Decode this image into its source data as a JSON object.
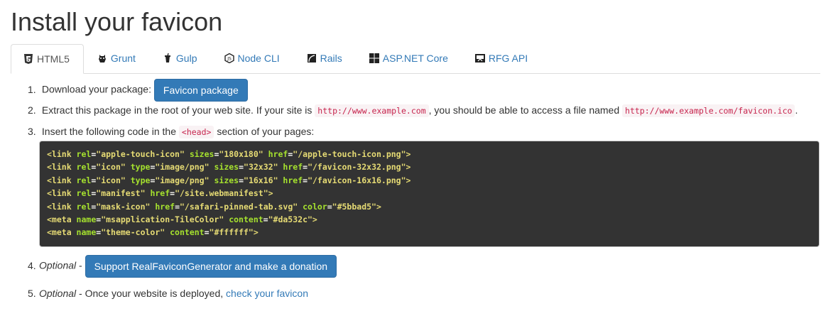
{
  "page": {
    "title": "Install your favicon"
  },
  "tabs": [
    {
      "label": "HTML5",
      "icon": "html5-icon",
      "active": true
    },
    {
      "label": "Grunt",
      "icon": "grunt-icon"
    },
    {
      "label": "Gulp",
      "icon": "gulp-icon"
    },
    {
      "label": "Node CLI",
      "icon": "nodejs-icon"
    },
    {
      "label": "Rails",
      "icon": "rails-icon"
    },
    {
      "label": "ASP.NET Core",
      "icon": "windows-icon"
    },
    {
      "label": "RFG API",
      "icon": "api-icon"
    }
  ],
  "steps": {
    "s1": {
      "num": "1.",
      "text": "Download your package:",
      "button": "Favicon package"
    },
    "s2": {
      "num": "2.",
      "text_a": "Extract this package in the root of your web site. If your site is",
      "code_a": "http://www.example.com",
      "text_b": ", you should be able to access a file named",
      "code_b": "http://www.example.com/favicon.ico",
      "text_c": "."
    },
    "s3": {
      "num": "3.",
      "text_a": "Insert the following code in the",
      "code": "<head>",
      "text_b": "section of your pages:"
    },
    "s4": {
      "num": "4.",
      "optional": "Optional",
      "dash": " - ",
      "button": "Support RealFaviconGenerator and make a donation"
    },
    "s5": {
      "num": "5.",
      "optional": "Optional",
      "text": " - Once your website is deployed, ",
      "link": "check your favicon"
    }
  },
  "code_lines": [
    [
      [
        "tag",
        "<link "
      ],
      [
        "attr",
        "rel"
      ],
      [
        "eq",
        "="
      ],
      [
        "val",
        "\"apple-touch-icon\" "
      ],
      [
        "attr",
        "sizes"
      ],
      [
        "eq",
        "="
      ],
      [
        "val",
        "\"180x180\" "
      ],
      [
        "attr",
        "href"
      ],
      [
        "eq",
        "="
      ],
      [
        "val",
        "\"/apple-touch-icon.png\""
      ],
      [
        "tag",
        ">"
      ]
    ],
    [
      [
        "tag",
        "<link "
      ],
      [
        "attr",
        "rel"
      ],
      [
        "eq",
        "="
      ],
      [
        "val",
        "\"icon\" "
      ],
      [
        "attr",
        "type"
      ],
      [
        "eq",
        "="
      ],
      [
        "val",
        "\"image/png\" "
      ],
      [
        "attr",
        "sizes"
      ],
      [
        "eq",
        "="
      ],
      [
        "val",
        "\"32x32\" "
      ],
      [
        "attr",
        "href"
      ],
      [
        "eq",
        "="
      ],
      [
        "val",
        "\"/favicon-32x32.png\""
      ],
      [
        "tag",
        ">"
      ]
    ],
    [
      [
        "tag",
        "<link "
      ],
      [
        "attr",
        "rel"
      ],
      [
        "eq",
        "="
      ],
      [
        "val",
        "\"icon\" "
      ],
      [
        "attr",
        "type"
      ],
      [
        "eq",
        "="
      ],
      [
        "val",
        "\"image/png\" "
      ],
      [
        "attr",
        "sizes"
      ],
      [
        "eq",
        "="
      ],
      [
        "val",
        "\"16x16\" "
      ],
      [
        "attr",
        "href"
      ],
      [
        "eq",
        "="
      ],
      [
        "val",
        "\"/favicon-16x16.png\""
      ],
      [
        "tag",
        ">"
      ]
    ],
    [
      [
        "tag",
        "<link "
      ],
      [
        "attr",
        "rel"
      ],
      [
        "eq",
        "="
      ],
      [
        "val",
        "\"manifest\" "
      ],
      [
        "attr",
        "href"
      ],
      [
        "eq",
        "="
      ],
      [
        "val",
        "\"/site.webmanifest\""
      ],
      [
        "tag",
        ">"
      ]
    ],
    [
      [
        "tag",
        "<link "
      ],
      [
        "attr",
        "rel"
      ],
      [
        "eq",
        "="
      ],
      [
        "val",
        "\"mask-icon\" "
      ],
      [
        "attr",
        "href"
      ],
      [
        "eq",
        "="
      ],
      [
        "val",
        "\"/safari-pinned-tab.svg\" "
      ],
      [
        "attr",
        "color"
      ],
      [
        "eq",
        "="
      ],
      [
        "val",
        "\"#5bbad5\""
      ],
      [
        "tag",
        ">"
      ]
    ],
    [
      [
        "tag",
        "<meta "
      ],
      [
        "attr",
        "name"
      ],
      [
        "eq",
        "="
      ],
      [
        "val",
        "\"msapplication-TileColor\" "
      ],
      [
        "attr",
        "content"
      ],
      [
        "eq",
        "="
      ],
      [
        "val",
        "\"#da532c\""
      ],
      [
        "tag",
        ">"
      ]
    ],
    [
      [
        "tag",
        "<meta "
      ],
      [
        "attr",
        "name"
      ],
      [
        "eq",
        "="
      ],
      [
        "val",
        "\"theme-color\" "
      ],
      [
        "attr",
        "content"
      ],
      [
        "eq",
        "="
      ],
      [
        "val",
        "\"#ffffff\""
      ],
      [
        "tag",
        ">"
      ]
    ]
  ],
  "colors": {
    "link": "#337ab7",
    "button": "#337ab7",
    "code_bg": "#333333"
  }
}
